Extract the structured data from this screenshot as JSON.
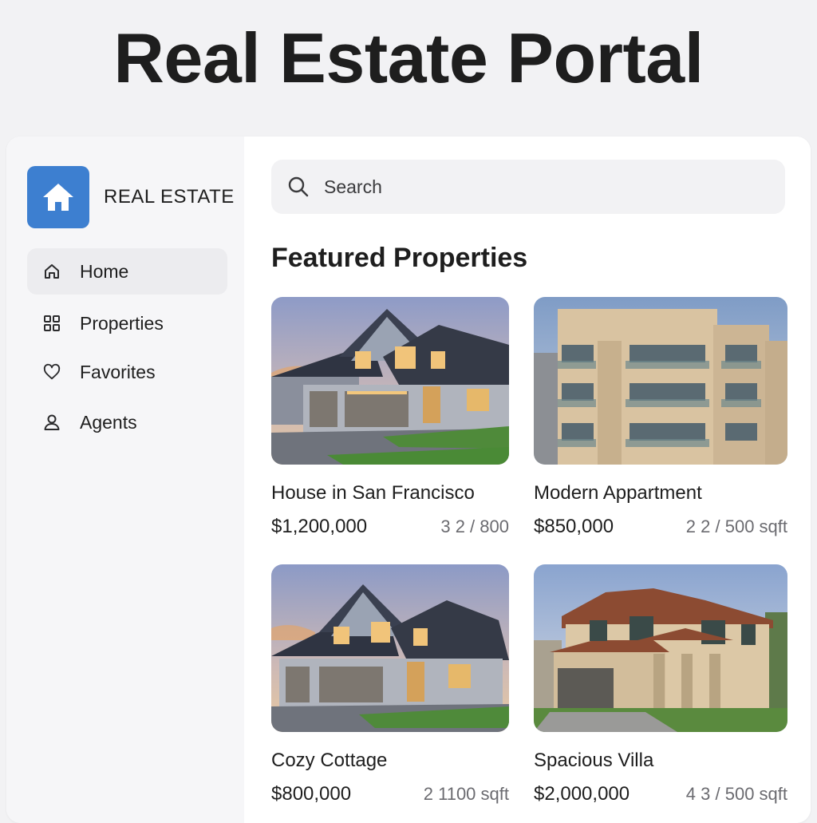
{
  "page_title": "Real Estate Portal",
  "brand": {
    "name": "REAL ESTATE",
    "icon": "house-icon",
    "accent": "#3d7fd0"
  },
  "sidebar": {
    "items": [
      {
        "label": "Home",
        "icon": "home-icon",
        "active": true
      },
      {
        "label": "Properties",
        "icon": "grid-icon",
        "active": false
      },
      {
        "label": "Favorites",
        "icon": "heart-icon",
        "active": false
      },
      {
        "label": "Agents",
        "icon": "user-icon",
        "active": false
      }
    ]
  },
  "search": {
    "placeholder": "Search",
    "icon": "search-icon"
  },
  "featured": {
    "title": "Featured Properties",
    "listings": [
      {
        "name": "House in San Francisco",
        "price": "$1,200,000",
        "specs": "3 2 / 800"
      },
      {
        "name": "Modern Appartment",
        "price": "$850,000",
        "specs": "2 2 / 500 sqft"
      },
      {
        "name": "Cozy Cottage",
        "price": "$800,000",
        "specs": "2 1100 sqft"
      },
      {
        "name": "Spacious Villa",
        "price": "$2,000,000",
        "specs": "4 3 / 500 sqft"
      }
    ]
  }
}
